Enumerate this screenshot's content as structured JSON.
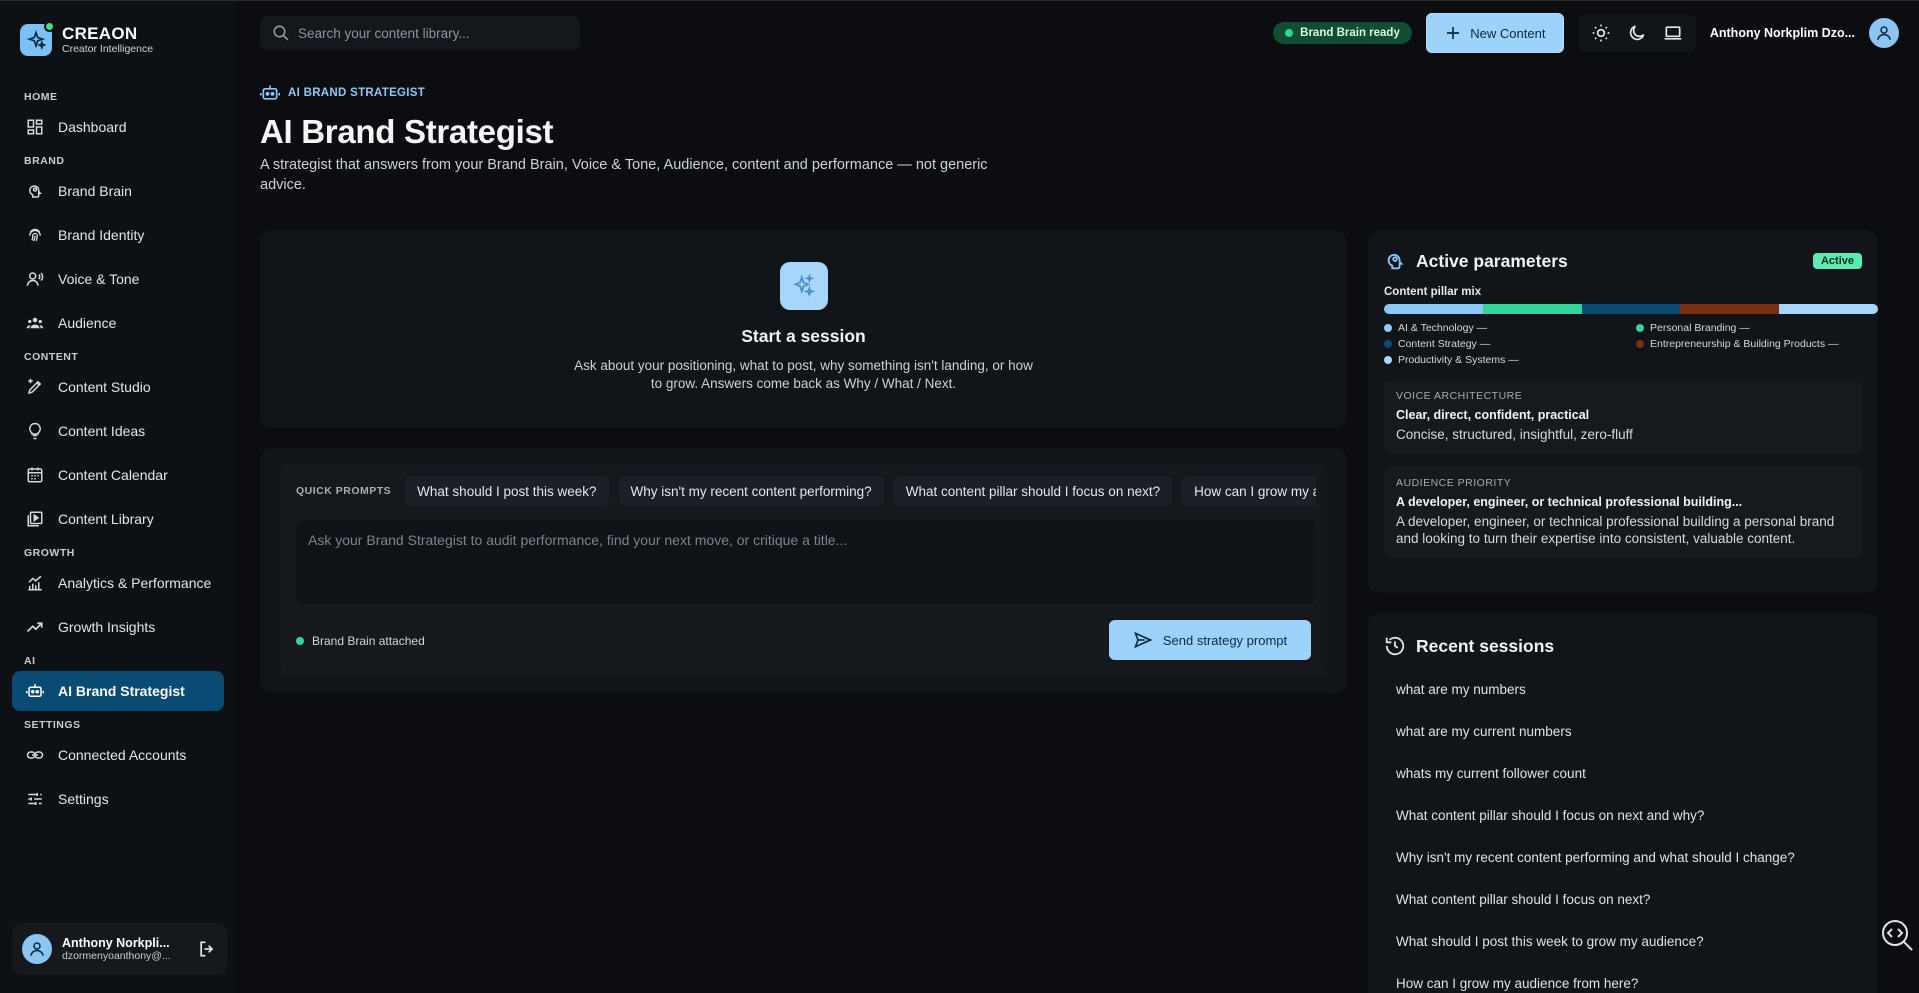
{
  "brand": {
    "name": "CREAON",
    "subtitle": "Creator Intelligence"
  },
  "nav": {
    "sections": {
      "home": "HOME",
      "brand": "BRAND",
      "content": "CONTENT",
      "growth": "GROWTH",
      "ai": "AI",
      "settings": "SETTINGS"
    },
    "items": {
      "dashboard": "Dashboard",
      "brand_brain": "Brand Brain",
      "brand_identity": "Brand Identity",
      "voice_tone": "Voice & Tone",
      "audience": "Audience",
      "content_studio": "Content Studio",
      "content_ideas": "Content Ideas",
      "content_calendar": "Content Calendar",
      "content_library": "Content Library",
      "analytics": "Analytics & Performance",
      "growth_insights": "Growth Insights",
      "ai_strategist": "AI Brand Strategist",
      "connected_accounts": "Connected Accounts",
      "settings": "Settings"
    }
  },
  "user": {
    "name": "Anthony Norkpli...",
    "email": "dzormenyoanthony@...",
    "top_name": "Anthony Norkplim Dzo..."
  },
  "topbar": {
    "search_placeholder": "Search your content library...",
    "brand_brain_status": "Brand Brain ready",
    "new_content": "New Content"
  },
  "page": {
    "eyebrow": "AI BRAND STRATEGIST",
    "title": "AI Brand Strategist",
    "description": "A strategist that answers from your Brand Brain, Voice & Tone, Audience, content and performance — not generic advice."
  },
  "session": {
    "title": "Start a session",
    "description": "Ask about your positioning, what to post, why something isn't landing, or how to grow. Answers come back as Why / What / Next."
  },
  "prompt": {
    "quick_label": "QUICK PROMPTS",
    "chips": [
      "What should I post this week?",
      "Why isn't my recent content performing?",
      "What content pillar should I focus on next?",
      "How can I grow my audience from here?"
    ],
    "placeholder": "Ask your Brand Strategist to audit performance, find your next move, or critique a title...",
    "attached": "Brand Brain attached",
    "send": "Send strategy prompt"
  },
  "params": {
    "title": "Active parameters",
    "badge": "Active",
    "mix_label": "Content pillar mix",
    "mix": [
      {
        "name": "AI & Technology —",
        "share": 20,
        "color": "#8cc8f5"
      },
      {
        "name": "Personal Branding —",
        "share": 20,
        "color": "#34d399"
      },
      {
        "name": "Content Strategy —",
        "share": 20,
        "color": "#0c4a74"
      },
      {
        "name": "Entrepreneurship & Building Products —",
        "share": 20,
        "color": "#7a2e12"
      },
      {
        "name": "Productivity & Systems —",
        "share": 20,
        "color": "#a7d6fb"
      }
    ],
    "voice": {
      "label": "VOICE ARCHITECTURE",
      "strong": "Clear, direct, confident, practical",
      "text": "Concise, structured, insightful, zero-fluff"
    },
    "audience": {
      "label": "AUDIENCE PRIORITY",
      "strong": "A developer, engineer, or technical professional building...",
      "text": "A developer, engineer, or technical professional building a personal brand and looking to turn their expertise into consistent, valuable content."
    }
  },
  "recent": {
    "title": "Recent sessions",
    "items": [
      "what are my numbers",
      "what are my current numbers",
      "whats my current follower count",
      "What content pillar should I focus on next and why?",
      "Why isn't my recent content performing and what should I change?",
      "What content pillar should I focus on next?",
      "What should I post this week to grow my audience?",
      "How can I grow my audience from here?"
    ]
  }
}
